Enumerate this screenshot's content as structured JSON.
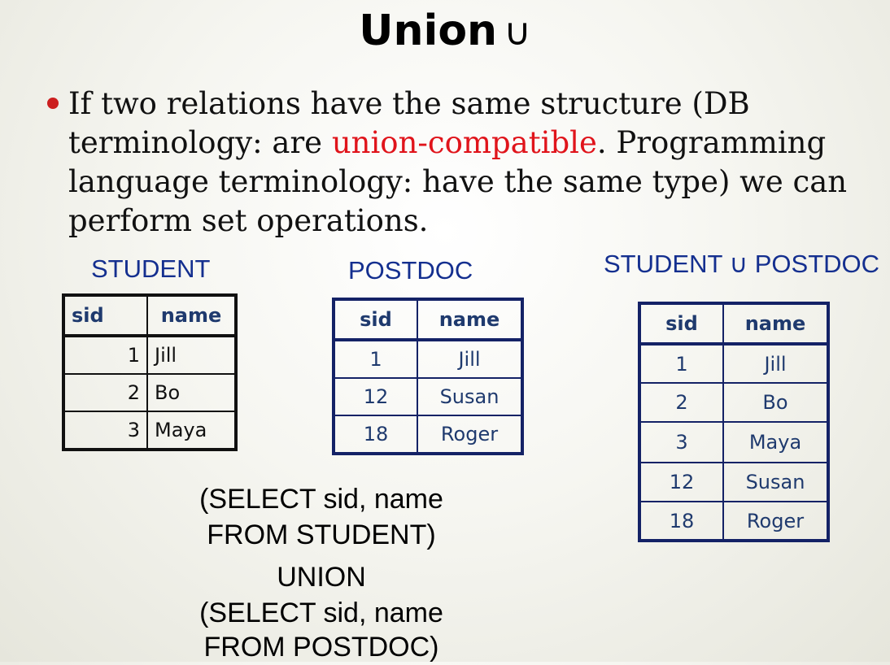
{
  "slide": {
    "title": "Union",
    "title_symbol": "∪",
    "bullet": {
      "part1": "If two relations have the same structure (DB terminology: are ",
      "highlight": "union-compatible",
      "part2": ". Programming language terminology: have the same type) we can perform set operations.",
      "highlight_color": "#e0141b"
    }
  },
  "student": {
    "label": "STUDENT",
    "headers": [
      "sid",
      "name"
    ],
    "rows": [
      [
        "1",
        "Jill"
      ],
      [
        "2",
        "Bo"
      ],
      [
        "3",
        "Maya"
      ]
    ]
  },
  "postdoc": {
    "label": "POSTDOC",
    "headers": [
      "sid",
      "name"
    ],
    "rows": [
      [
        "1",
        "Jill"
      ],
      [
        "12",
        "Susan"
      ],
      [
        "18",
        "Roger"
      ]
    ]
  },
  "result": {
    "label": "STUDENT ∪ POSTDOC",
    "headers": [
      "sid",
      "name"
    ],
    "rows": [
      [
        "1",
        "Jill"
      ],
      [
        "2",
        "Bo"
      ],
      [
        "3",
        "Maya"
      ],
      [
        "12",
        "Susan"
      ],
      [
        "18",
        "Roger"
      ]
    ]
  },
  "sql": {
    "lines": [
      "(SELECT sid, name",
      "FROM STUDENT)",
      "UNION",
      "(SELECT sid, name",
      "FROM POSTDOC)"
    ]
  }
}
